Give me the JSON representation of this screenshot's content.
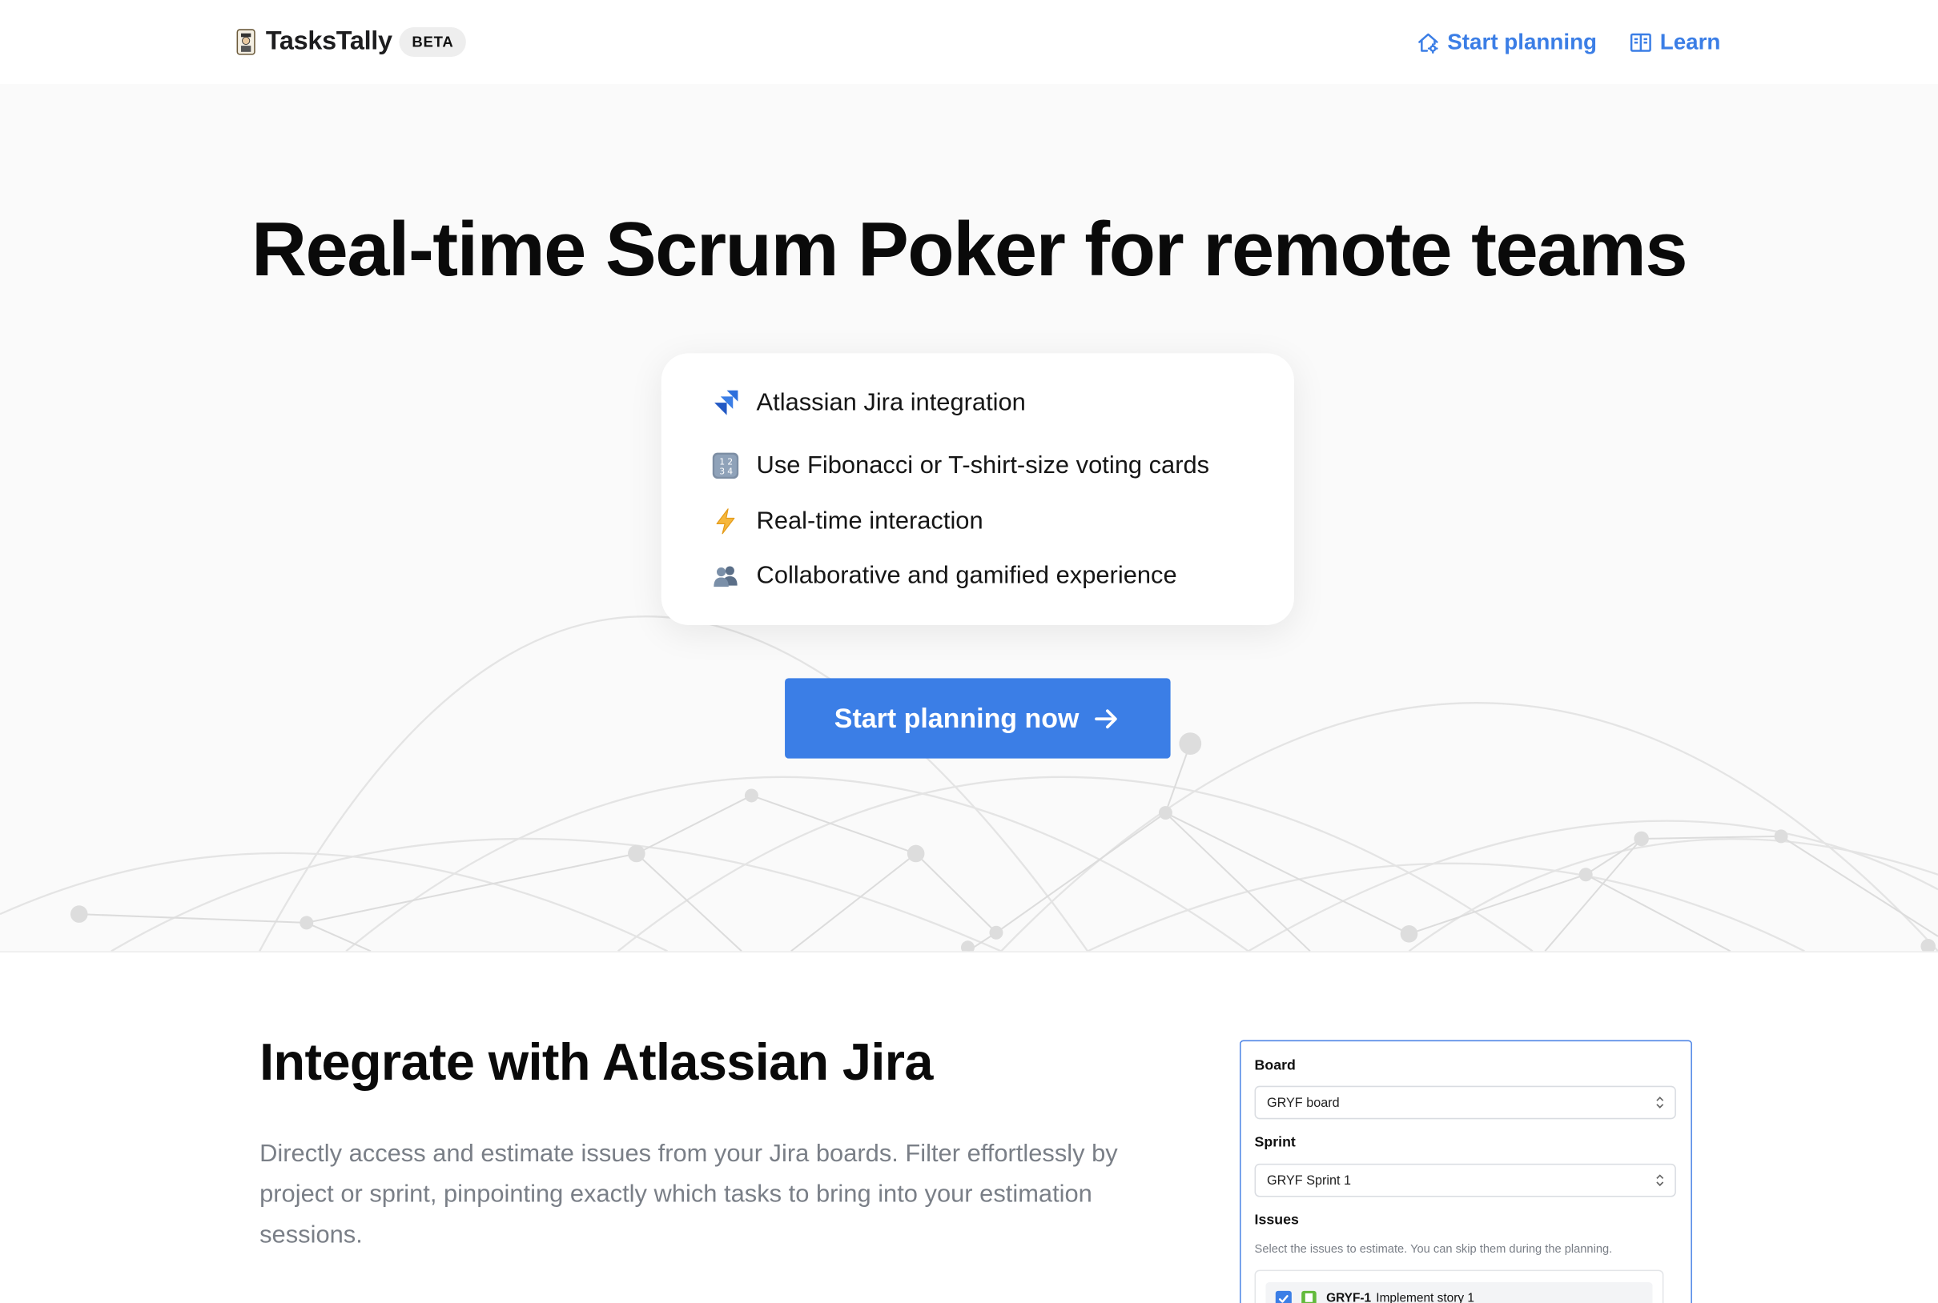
{
  "header": {
    "logo_text": "TasksTally",
    "beta_label": "BETA",
    "nav": {
      "start_planning": "Start planning",
      "learn": "Learn"
    }
  },
  "hero": {
    "title": "Real-time Scrum Poker for remote teams",
    "features": [
      {
        "icon": "jira-logo-icon",
        "text": "Atlassian Jira integration"
      },
      {
        "icon": "number-keys-icon",
        "text": "Use Fibonacci or T-shirt-size voting cards"
      },
      {
        "icon": "lightning-icon",
        "text": "Real-time interaction"
      },
      {
        "icon": "two-people-icon",
        "text": "Collaborative and gamified experience"
      }
    ],
    "cta_label": "Start planning now"
  },
  "jira_section": {
    "title": "Integrate with Atlassian Jira",
    "description": "Directly access and estimate issues from your Jira boards. Filter effortlessly by project or sprint, pinpointing exactly which tasks to bring into your estimation sessions.",
    "panel": {
      "board_label": "Board",
      "board_value": "GRYF board",
      "sprint_label": "Sprint",
      "sprint_value": "GRYF Sprint 1",
      "issues_label": "Issues",
      "issues_hint": "Select the issues to estimate. You can skip them during the planning.",
      "issues": [
        {
          "key": "GRYF-1",
          "summary": "Implement story 1",
          "checked": true
        }
      ]
    }
  },
  "colors": {
    "accent": "#3b7ee6",
    "hero_bg": "#fafafa",
    "muted_text": "#7a7f87"
  }
}
